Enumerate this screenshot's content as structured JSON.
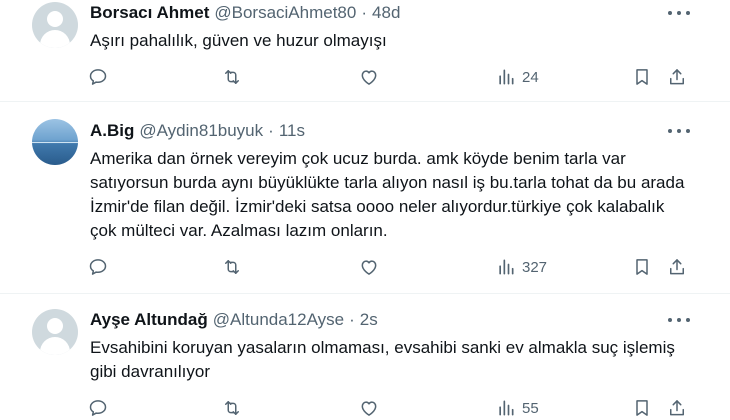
{
  "tweets": [
    {
      "name": "Borsacı Ahmet",
      "handle": "@BorsaciAhmet80",
      "separator": "·",
      "time": "48d",
      "text": "Aşırı pahalılık, güven ve huzur olmayışı",
      "views": "24",
      "avatar": "default-avatar"
    },
    {
      "name": "A.Big",
      "handle": "@Aydin81buyuk",
      "separator": "·",
      "time": "11s",
      "text": "Amerika dan örnek vereyim çok ucuz burda. amk köyde benim tarla var satıyorsun burda aynı büyüklükte tarla alıyon nasıl iş bu.tarla tohat da bu arada İzmir'de filan değil. İzmir'deki satsa oooo neler alıyordur.türkiye çok kalabalık çok mülteci var. Azalması lazım onların.",
      "views": "327",
      "avatar": "sea-photo-avatar"
    },
    {
      "name": "Ayşe Altundağ",
      "handle": "@Altunda12Ayse",
      "separator": "·",
      "time": "2s",
      "text": "Evsahibini koruyan yasaların olmaması, evsahibi sanki ev almakla suç işlemiş gibi davranılıyor",
      "views": "55",
      "avatar": "default-avatar"
    }
  ],
  "icons": {
    "reply": "reply-icon",
    "retweet": "retweet-icon",
    "like": "heart-icon",
    "views": "views-icon",
    "bookmark": "bookmark-icon",
    "share": "share-icon",
    "more": "more-icon"
  },
  "colors": {
    "text": "#0f1419",
    "secondary": "#536471",
    "divider": "#eff3f4",
    "avatar_default": "#cfd9de"
  }
}
